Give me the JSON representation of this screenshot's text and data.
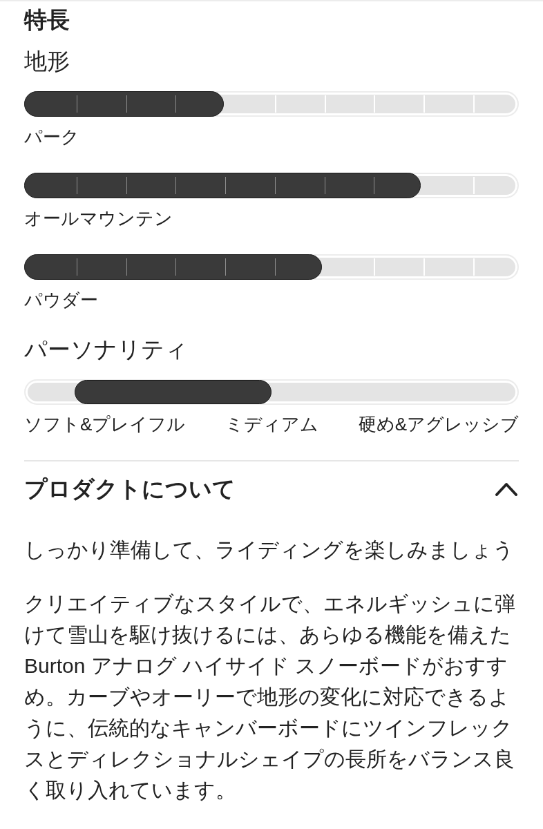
{
  "features": {
    "title": "特長",
    "terrain": {
      "title": "地形",
      "meters": [
        {
          "label": "パーク",
          "level": 0.4
        },
        {
          "label": "オールマウンテン",
          "level": 0.8
        },
        {
          "label": "パウダー",
          "level": 0.6
        }
      ]
    },
    "personality": {
      "title": "パーソナリティ",
      "level": 0.3,
      "scale_labels": [
        "ソフト&プレイフル",
        "ミディアム",
        "硬め&アグレッシブ"
      ]
    }
  },
  "product_info": {
    "title": "プロダクトについて",
    "expanded": true,
    "paragraphs": [
      "しっかり準備して、ライディングを楽しみましょう",
      "クリエイティブなスタイルで、エネルギッシュに弾けて雪山を駆け抜けるには、あらゆる機能を備えたBurton アナログ ハイサイド スノーボードがおすすめ。カーブやオーリーで地形の変化に対応できるように、伝統的なキャンバーボードにツインフレックスとディレクショナルシェイプの長所をバランス良く取り入れています。"
    ]
  }
}
